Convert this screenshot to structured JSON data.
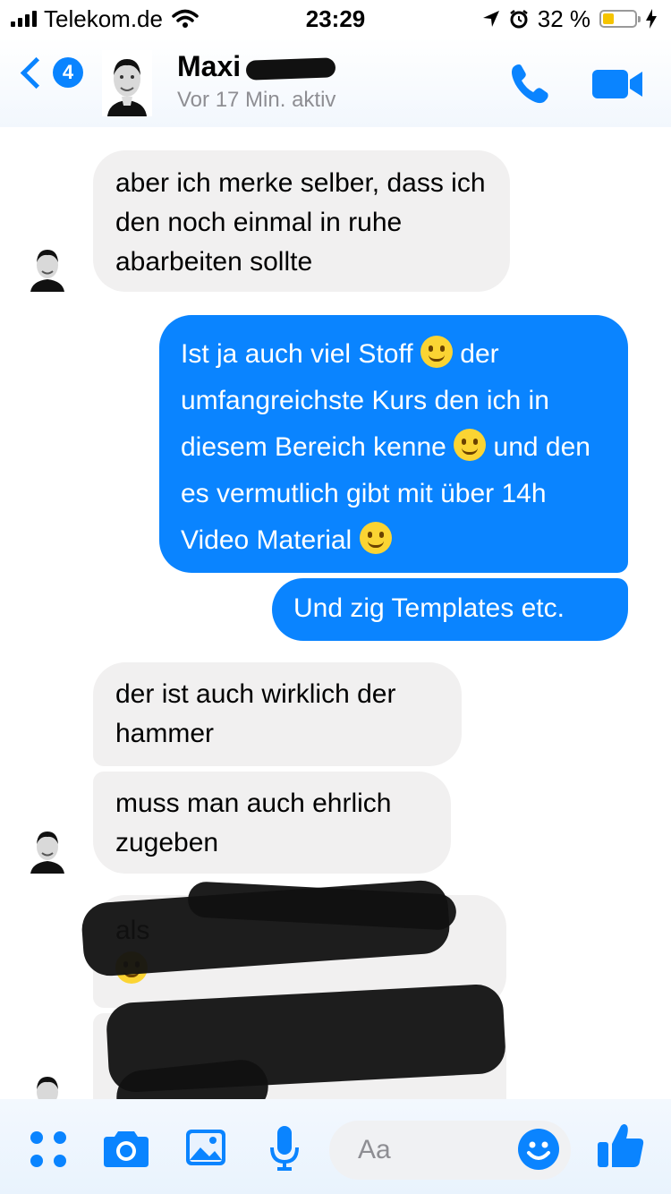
{
  "status_bar": {
    "carrier": "Telekom.de",
    "time": "23:29",
    "battery": "32 %",
    "battery_level": 0.32
  },
  "header": {
    "back_count": "4",
    "name": "Maxi",
    "status": "Vor 17 Min. aktiv"
  },
  "messages": [
    {
      "dir": "in",
      "text": "aber ich merke selber, dass ich den noch einmal in ruhe abarbeiten sollte"
    },
    {
      "dir": "out",
      "p1": "Ist ja auch viel Stoff",
      "p2": "der umfangreichste Kurs den ich in diesem Bereich kenne",
      "p3": "und den es vermutlich gibt mit über 14h Video Material",
      "emojis": [
        "grinning-sweat-emoji",
        "wink-emoji",
        "smile-emoji"
      ]
    },
    {
      "dir": "out",
      "text": "Und zig Templates etc."
    },
    {
      "dir": "in",
      "text": "der ist auch wirklich der hammer"
    },
    {
      "dir": "in",
      "text": "muss man auch ehrlich zugeben"
    },
    {
      "dir": "in",
      "text": "als",
      "redacted": true
    },
    {
      "dir": "in",
      "text": "",
      "redacted": true
    }
  ],
  "composer": {
    "placeholder": "Aa"
  },
  "colors": {
    "accent": "#0a84ff",
    "incoming_bubble": "#f1f0f0"
  }
}
